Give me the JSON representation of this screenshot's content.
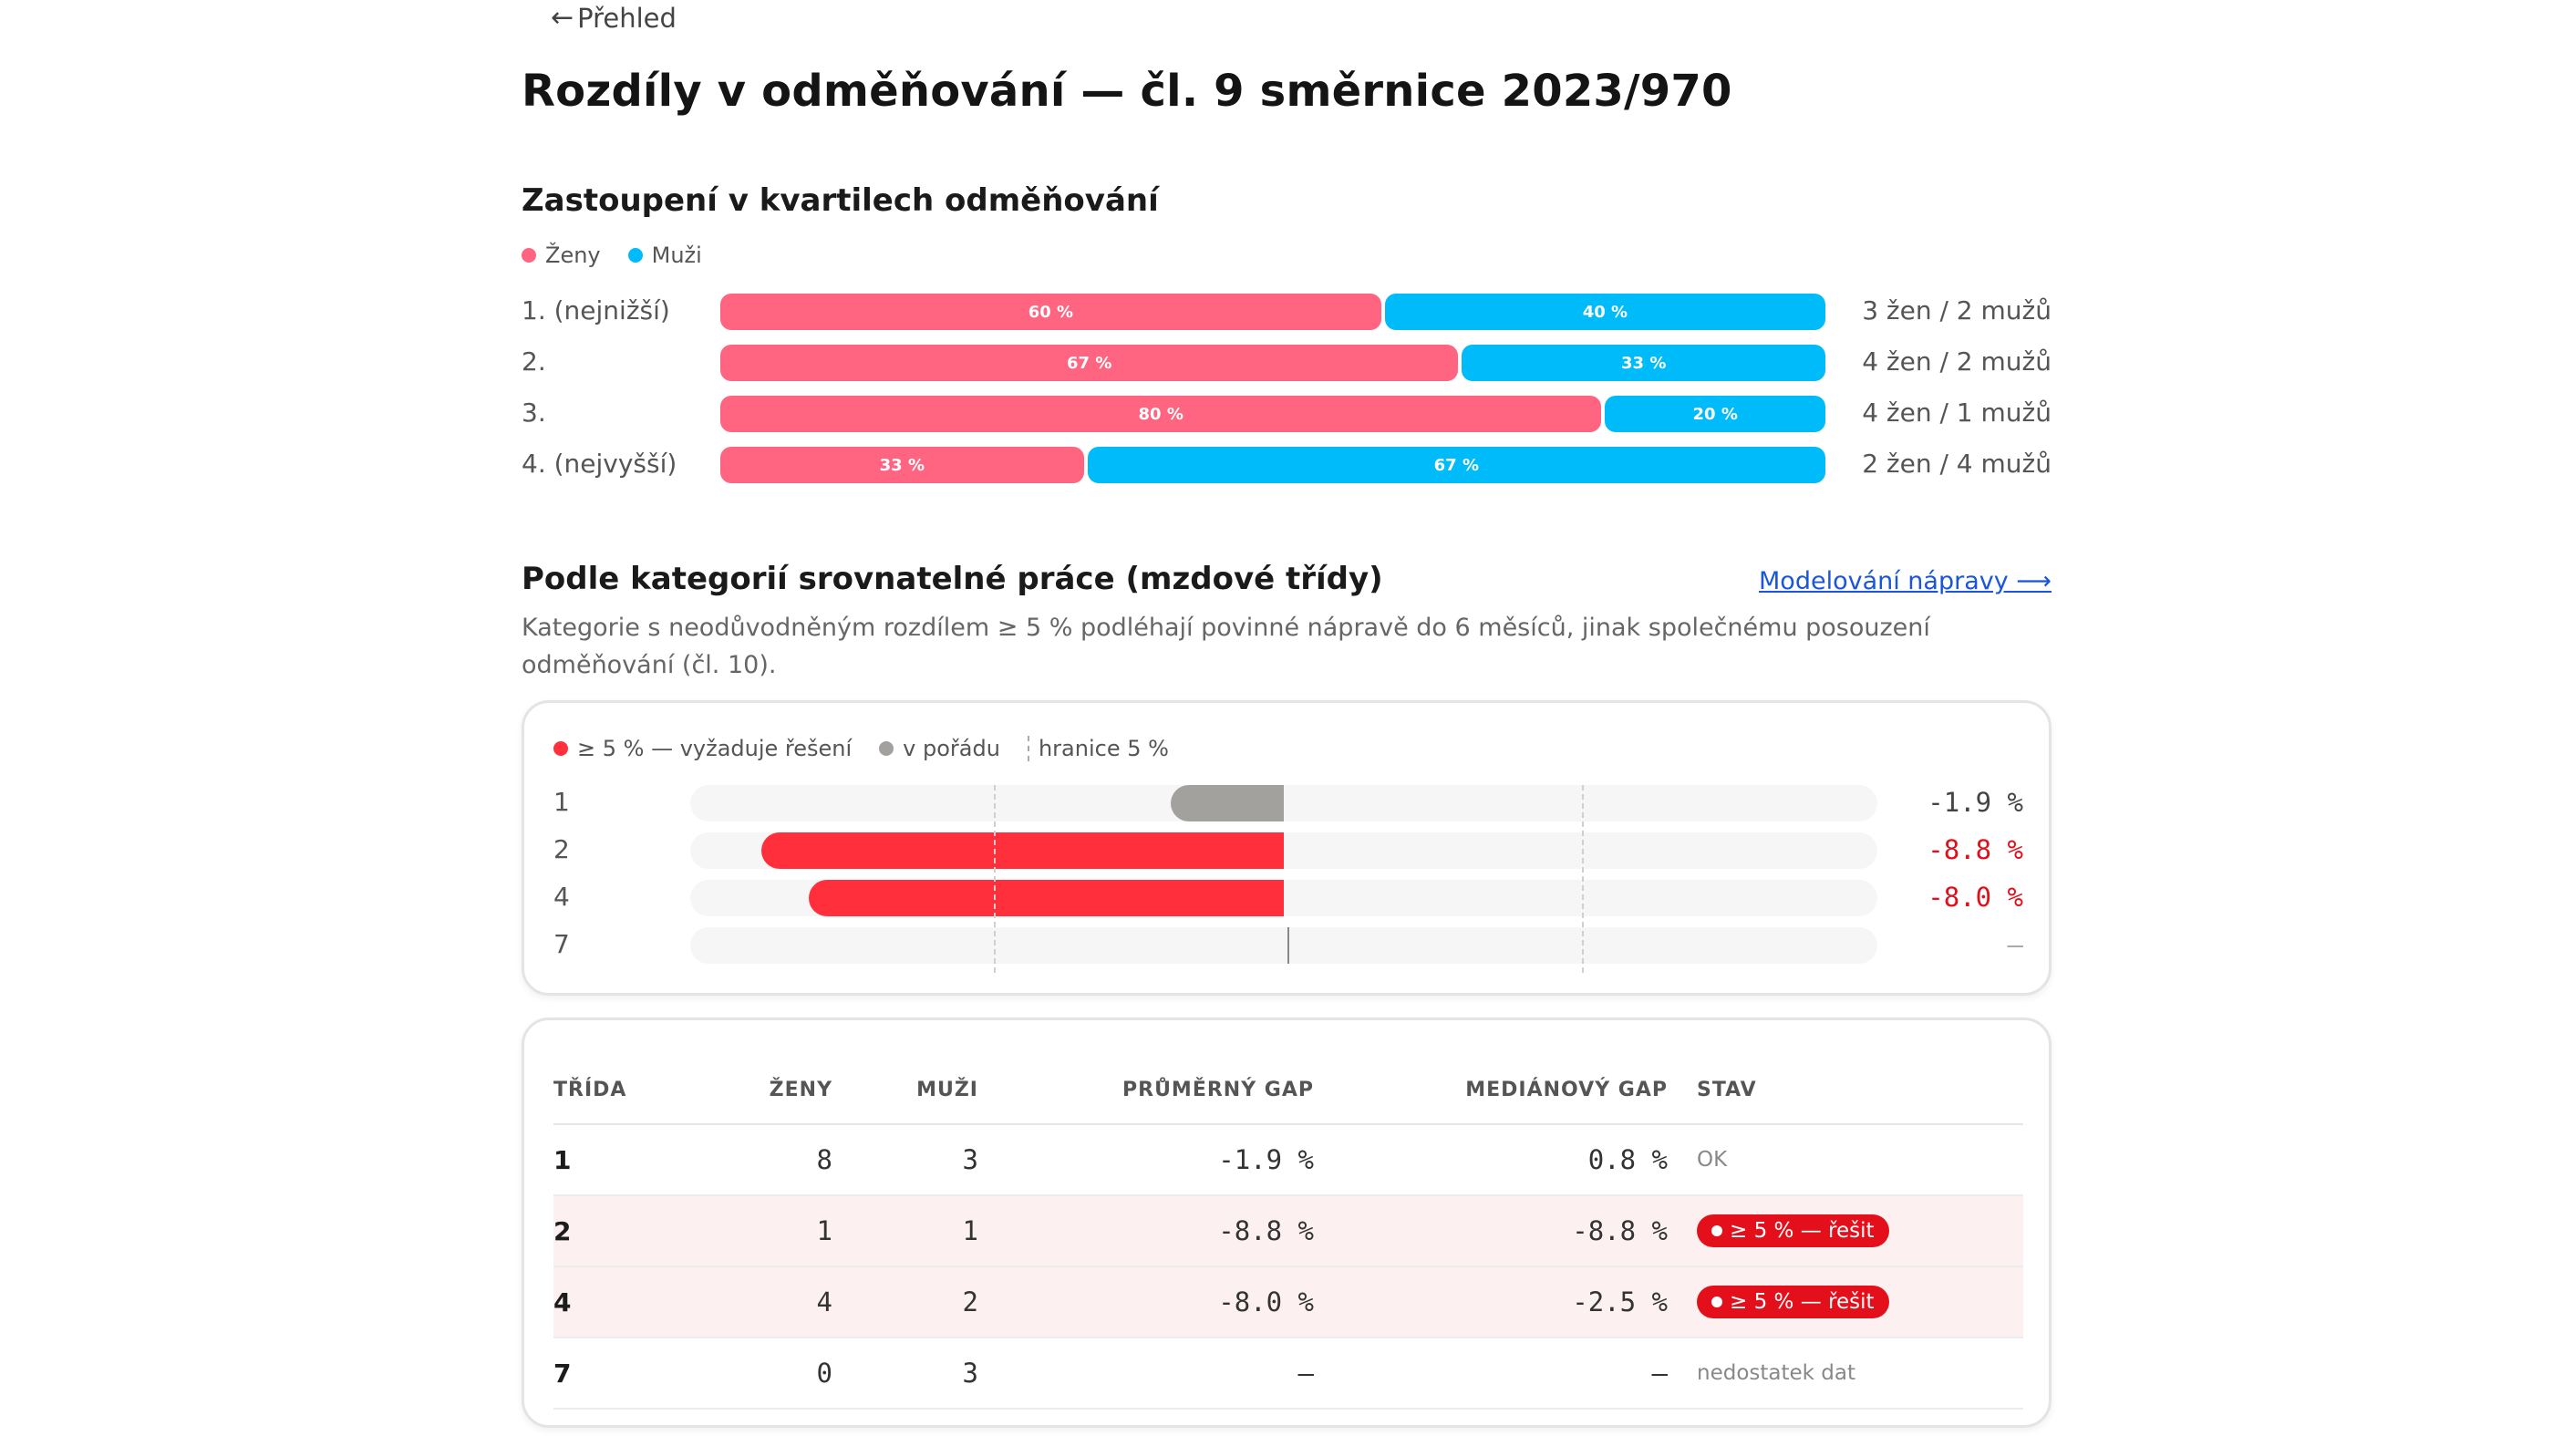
{
  "nav": {
    "back_label": "Přehled"
  },
  "page": {
    "title": "Rozdíly v odměňování — čl. 9 směrnice 2023/970"
  },
  "quartiles": {
    "heading": "Zastoupení v kvartilech odměňování",
    "legend": {
      "women": "Ženy",
      "men": "Muži"
    },
    "colors": {
      "women": "#ff6480",
      "men": "#00bbf9"
    },
    "rows": [
      {
        "label": "1. (nejnižší)",
        "women_pct": 60,
        "men_pct": 40,
        "women_label": "60 %",
        "men_label": "40 %",
        "count": "3 žen / 2 mužů"
      },
      {
        "label": "2.",
        "women_pct": 67,
        "men_pct": 33,
        "women_label": "67 %",
        "men_label": "33 %",
        "count": "4 žen / 2 mužů"
      },
      {
        "label": "3.",
        "women_pct": 80,
        "men_pct": 20,
        "women_label": "80 %",
        "men_label": "20 %",
        "count": "4 žen / 1 mužů"
      },
      {
        "label": "4. (nejvyšší)",
        "women_pct": 33,
        "men_pct": 67,
        "women_label": "33 %",
        "men_label": "67 %",
        "count": "2 žen / 4 mužů"
      }
    ]
  },
  "categories": {
    "heading": "Podle kategorií srovnatelné práce (mzdové třídy)",
    "link_label": "Modelování nápravy ⟶",
    "description": "Kategorie s neodůvodněným rozdílem ≥ 5 % podléhají povinné nápravě do 6 měsíců, jinak společnému posouzení odměňování (čl. 10).",
    "legend": {
      "over": "≥ 5 % — vyžaduje řešení",
      "ok": "v pořádu",
      "threshold": "hranice 5 %"
    },
    "colors": {
      "over": "#ff303b",
      "ok": "#a3a19e"
    },
    "chart": {
      "rows": [
        {
          "cat": "1",
          "gap": -1.9,
          "label": "-1.9 %",
          "status": "ok"
        },
        {
          "cat": "2",
          "gap": -8.8,
          "label": "-8.8 %",
          "status": "over"
        },
        {
          "cat": "4",
          "gap": -8.0,
          "label": "-8.0 %",
          "status": "over"
        },
        {
          "cat": "7",
          "gap": null,
          "label": "—",
          "status": "none"
        }
      ]
    },
    "table": {
      "headers": {
        "cls": "TŘÍDA",
        "women": "ŽENY",
        "men": "MUŽI",
        "mean": "PRŮMĚRNÝ GAP",
        "median": "MEDIÁNOVÝ GAP",
        "status": "STAV"
      },
      "rows": [
        {
          "cls": "1",
          "women": "8",
          "men": "3",
          "mean": "-1.9 %",
          "median": "0.8 %",
          "status": "OK",
          "flag": false
        },
        {
          "cls": "2",
          "women": "1",
          "men": "1",
          "mean": "-8.8 %",
          "median": "-8.8 %",
          "status": "≥ 5 % — řešit",
          "flag": true
        },
        {
          "cls": "4",
          "women": "4",
          "men": "2",
          "mean": "-8.0 %",
          "median": "-2.5 %",
          "status": "≥ 5 % — řešit",
          "flag": true
        },
        {
          "cls": "7",
          "women": "0",
          "men": "3",
          "mean": "—",
          "median": "—",
          "status": "nedostatek dat",
          "flag": false
        }
      ]
    }
  }
}
